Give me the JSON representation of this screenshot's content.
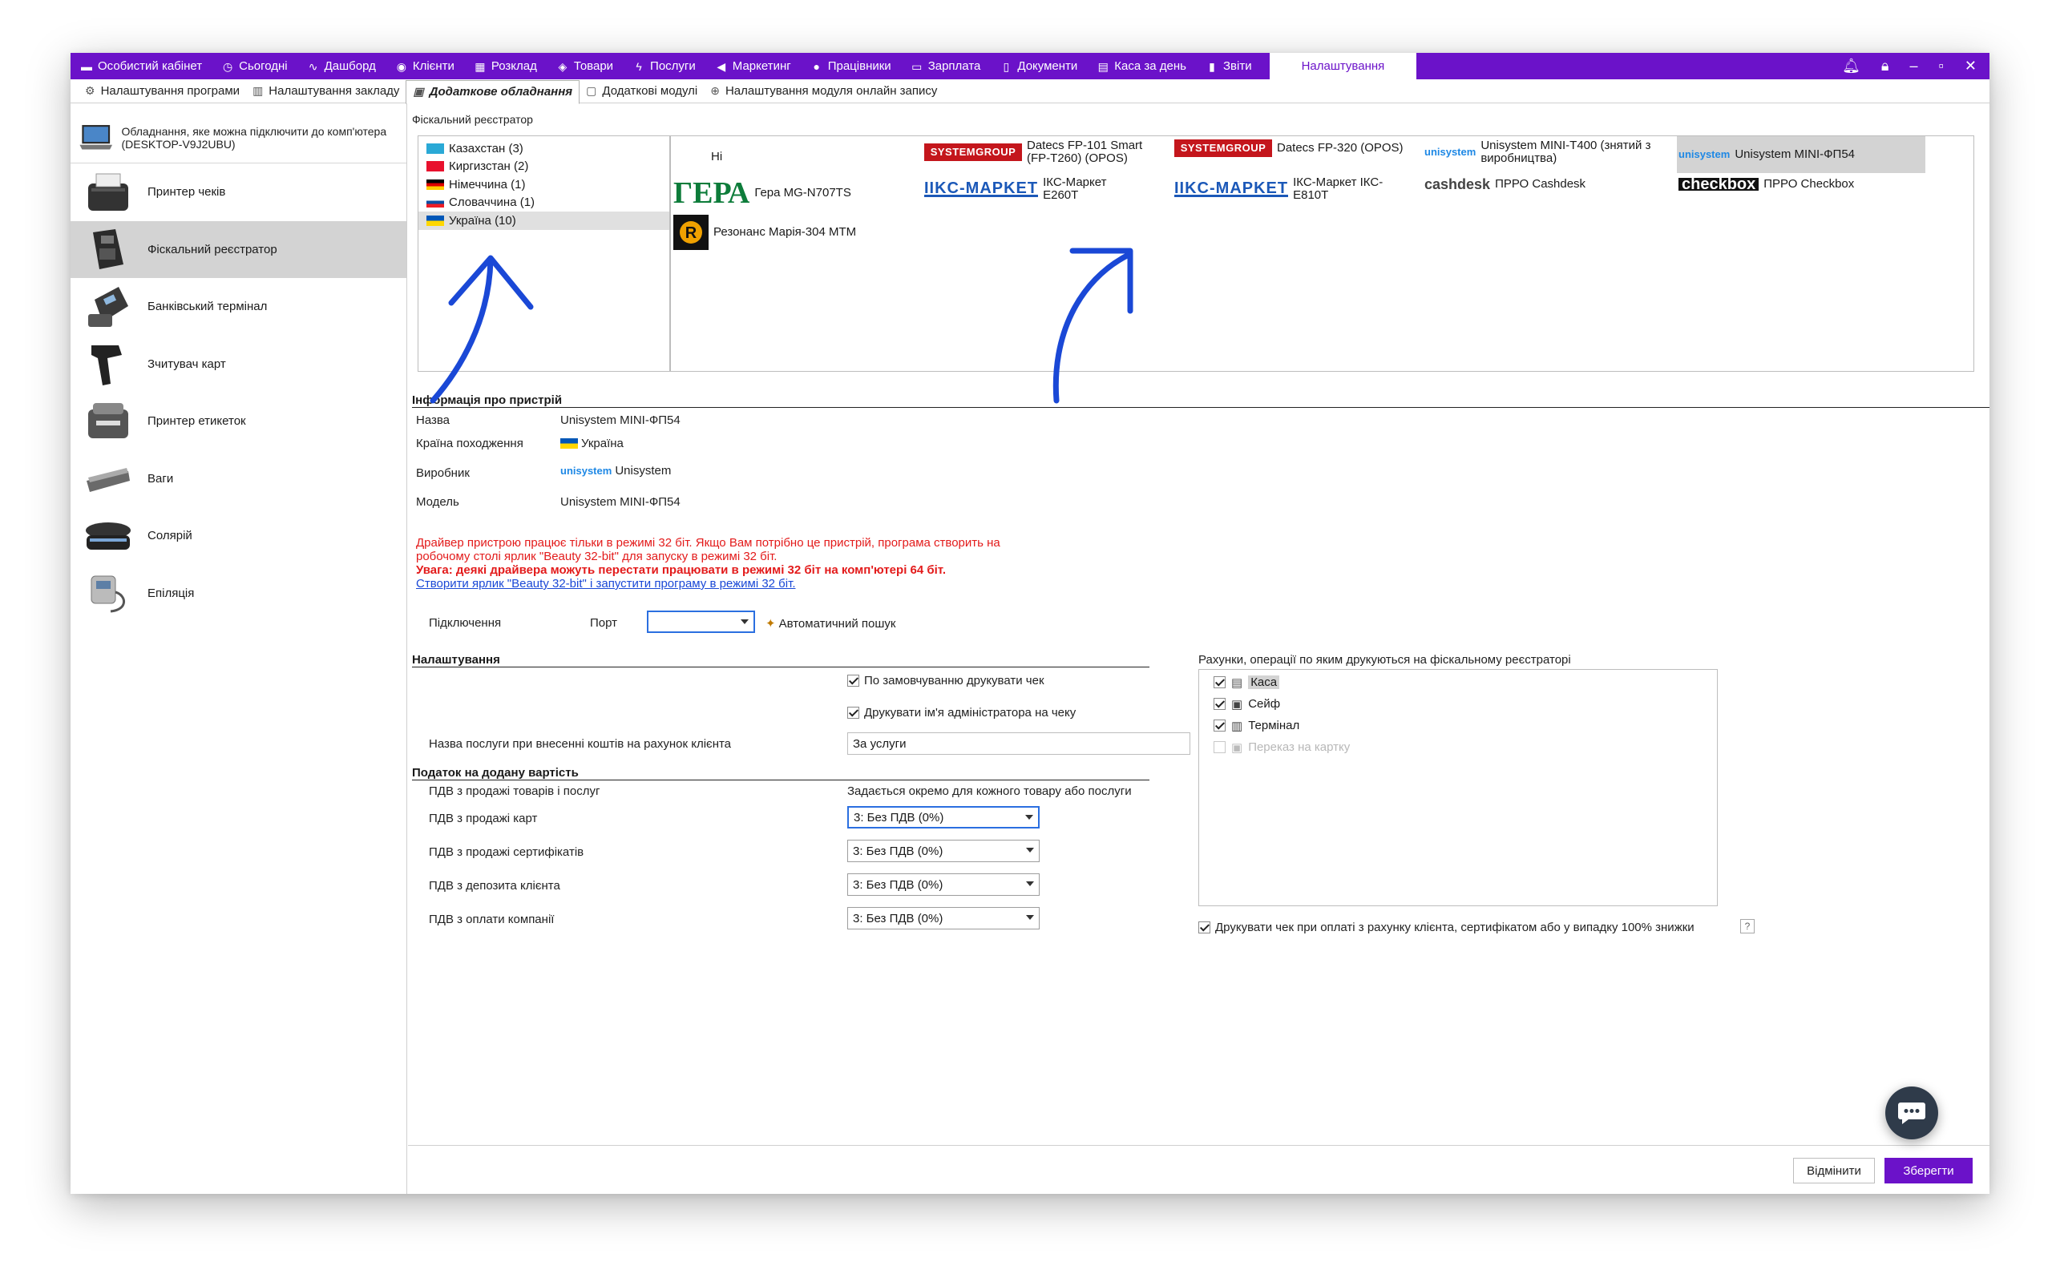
{
  "nav": {
    "items": [
      {
        "icon": "briefcase-icon",
        "label": "Особистий кабінет"
      },
      {
        "icon": "clock-icon",
        "label": "Сьогодні"
      },
      {
        "icon": "pulse-icon",
        "label": "Дашборд"
      },
      {
        "icon": "user-circle-icon",
        "label": "Клієнти"
      },
      {
        "icon": "calendar-icon",
        "label": "Розклад"
      },
      {
        "icon": "box-icon",
        "label": "Товари"
      },
      {
        "icon": "bolt-icon",
        "label": "Послуги"
      },
      {
        "icon": "megaphone-icon",
        "label": "Маркетинг"
      },
      {
        "icon": "person-icon",
        "label": "Працівники"
      },
      {
        "icon": "cash-icon",
        "label": "Зарплата"
      },
      {
        "icon": "document-icon",
        "label": "Документи"
      },
      {
        "icon": "calculator-icon",
        "label": "Каса за день"
      },
      {
        "icon": "bar-chart-icon",
        "label": "Звіти"
      }
    ],
    "active": "Налаштування"
  },
  "subtabs": [
    {
      "icon": "gear-icon",
      "label": "Налаштування програми"
    },
    {
      "icon": "building-icon",
      "label": "Налаштування закладу"
    },
    {
      "icon": "printer-icon",
      "label": "Додаткове обладнання"
    },
    {
      "icon": "window-icon",
      "label": "Додаткові модулі"
    },
    {
      "icon": "globe-icon",
      "label": "Налаштування модуля онлайн запису"
    }
  ],
  "left": {
    "computer_label": "Обладнання, яке можна підключити до комп'ютера (DESKTOP-V9J2UBU)",
    "devices": [
      {
        "name": "printer",
        "label": "Принтер чеків"
      },
      {
        "name": "fiscal",
        "label": "Фіскальний реєстратор"
      },
      {
        "name": "terminal",
        "label": "Банківський термінал"
      },
      {
        "name": "scanner",
        "label": "Зчитувач карт"
      },
      {
        "name": "label-printer",
        "label": "Принтер етикеток"
      },
      {
        "name": "scales",
        "label": "Ваги"
      },
      {
        "name": "solarium",
        "label": "Солярій"
      },
      {
        "name": "epilation",
        "label": "Епіляція"
      }
    ]
  },
  "fiscal": {
    "section_label": "Фіскальний реєстратор",
    "countries": [
      "Казахстан (3)",
      "Киргизстан (2)",
      "Німеччина (1)",
      "Словаччина (1)",
      "Україна (10)"
    ],
    "tiles": {
      "none": "Ні",
      "gera_logo": "ГЕРА",
      "gera": "Гера MG-N707TS",
      "rezonans": "Резонанс Марія-304 МТМ",
      "sg_logo": "SYSTEMGROUP",
      "datecs101": "Datecs FP-101 Smart (FP-T260) (OPOS)",
      "iks_logo": "IIKC-MAPKET",
      "iks260": "ІКС-Маркет Е260Т",
      "datecs320": "Datecs FP-320 (OPOS)",
      "iks810": "ІКС-Маркет ІКС-Е810Т",
      "uni_logo": "unisystem",
      "uni_t400": "Unisystem MINI-T400 (знятий з виробництва)",
      "cash_logo": "cashdesk",
      "cashdesk": "ПРРО Cashdesk",
      "uni_fp54": "Unisystem MINI-ФП54",
      "check_logo": "checkbox",
      "checkbox": "ПРРО Checkbox"
    }
  },
  "info": {
    "header": "Інформація про пристрій",
    "name_label": "Назва",
    "name_value": "Unisystem MINI-ФП54",
    "country_label": "Країна походження",
    "country_value": "Україна",
    "maker_label": "Виробник",
    "maker_value": "Unisystem",
    "model_label": "Модель",
    "model_value": "Unisystem MINI-ФП54",
    "warn1": "Драйвер пристрою працює тільки в режимі 32 біт. Якщо Вам потрібно це пристрій, програма створить на робочому столі ярлик \"Beauty 32-bit\" для запуску в режимі 32 біт.",
    "warn2": "Увага: деякі драйвера можуть перестати працювати в режимі 32 біт на комп'ютері 64 біт.",
    "link": "Створити ярлик \"Beauty 32-bit\" і запустити програму в режимі 32 біт.",
    "connection_label": "Підключення",
    "port_label": "Порт",
    "port_value": "",
    "autosearch": "Автоматичний пошук"
  },
  "settings": {
    "header": "Налаштування",
    "print_default": "По замовчуванню друкувати чек",
    "print_admin": "Друкувати ім'я адміністратора на чеку",
    "service_label": "Назва послуги при внесенні коштів на рахунок клієнта",
    "service_value": "За услуги"
  },
  "vat": {
    "header": "Податок на додану вартість",
    "goods_label": "ПДВ з продажі товарів і послуг",
    "goods_value": "Задається окремо для кожного товару або послуги",
    "rows": [
      {
        "label": "ПДВ з продажі карт",
        "value": "3: Без ПДВ (0%)"
      },
      {
        "label": "ПДВ з продажі сертифікатів",
        "value": "3: Без ПДВ (0%)"
      },
      {
        "label": "ПДВ з депозита клієнта",
        "value": "3: Без ПДВ (0%)"
      },
      {
        "label": "ПДВ з оплати компанії",
        "value": "3: Без ПДВ (0%)"
      }
    ]
  },
  "accounts": {
    "header": "Рахунки, операції по яким друкуються на фіскальному реєстраторі",
    "items": [
      {
        "label": "Каса",
        "checked": true
      },
      {
        "label": "Сейф",
        "checked": true
      },
      {
        "label": "Термінал",
        "checked": true
      },
      {
        "label": "Переказ на картку",
        "checked": false
      }
    ],
    "print_on_account": "Друкувати чек при оплаті з рахунку клієнта, сертифікатом або у випадку 100% знижки",
    "help": "?"
  },
  "buttons": {
    "cancel": "Відмінити",
    "save": "Зберегти"
  },
  "colors": {
    "brand": "#6b12c9",
    "warning": "#e31b1b",
    "link": "#1a48d6",
    "annotation_arrow": "#1a48d6"
  }
}
